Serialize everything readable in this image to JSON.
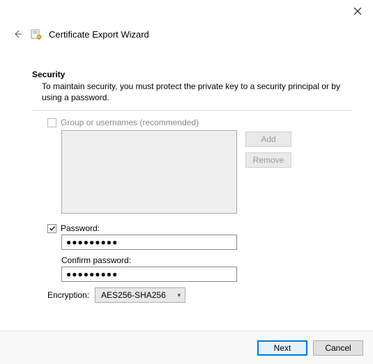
{
  "window": {
    "title": "Certificate Export Wizard"
  },
  "section": {
    "heading": "Security",
    "description": "To maintain security, you must protect the private key to a security principal or by using a password."
  },
  "groups": {
    "checkbox_label": "Group or usernames (recommended)",
    "checked": false,
    "add_label": "Add",
    "remove_label": "Remove"
  },
  "password": {
    "checkbox_label": "Password:",
    "checked": true,
    "value": "●●●●●●●●●",
    "confirm_label": "Confirm password:",
    "confirm_value": "●●●●●●●●●"
  },
  "encryption": {
    "label": "Encryption:",
    "selected": "AES256-SHA256"
  },
  "footer": {
    "next": "Next",
    "cancel": "Cancel"
  }
}
